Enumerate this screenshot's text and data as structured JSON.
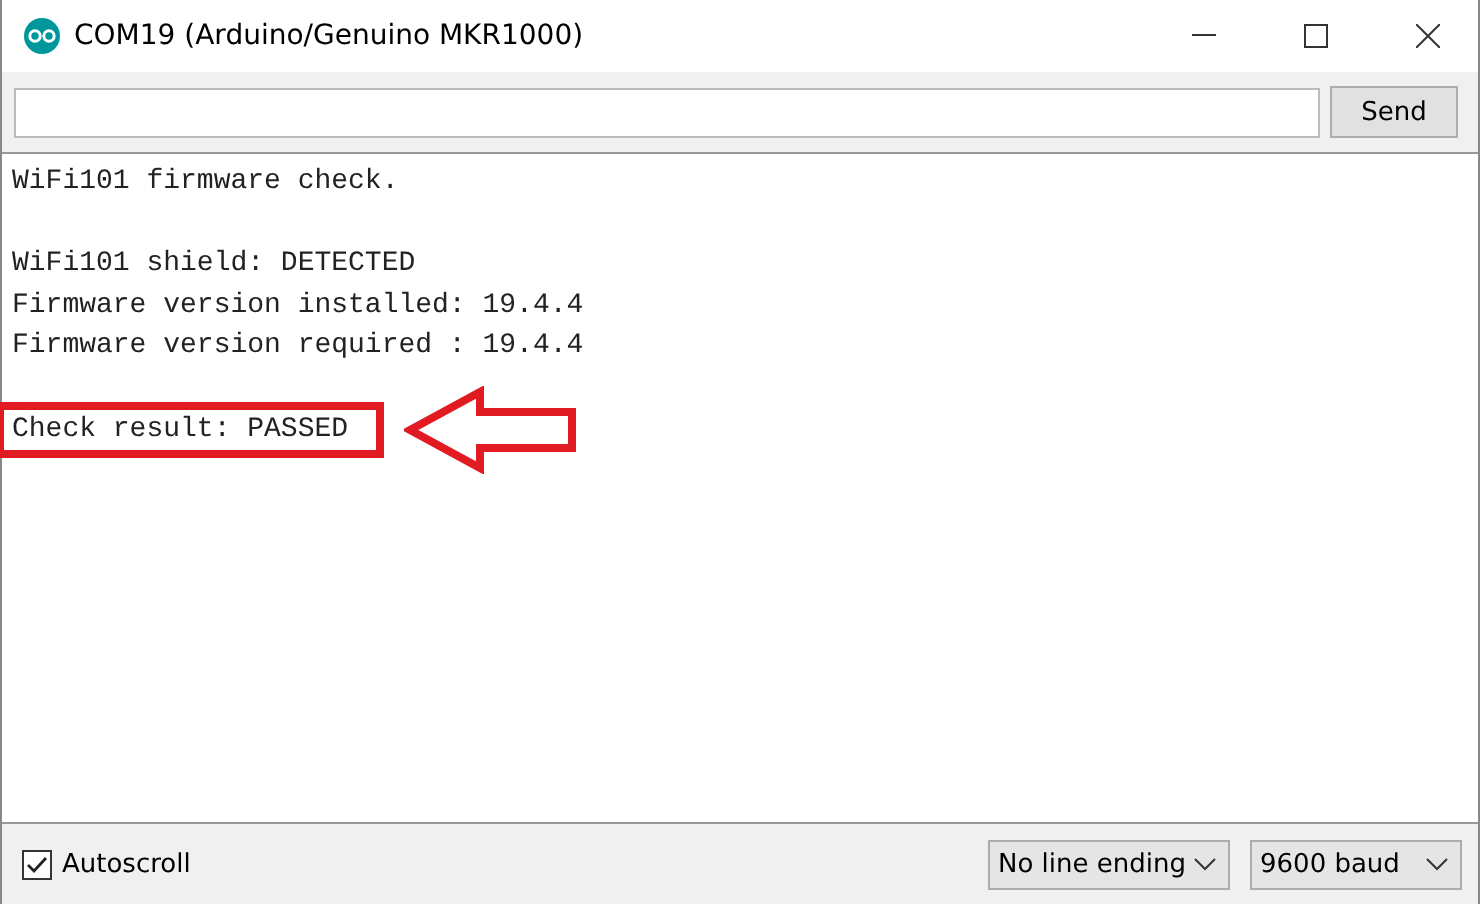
{
  "window": {
    "title": "COM19 (Arduino/Genuino MKR1000)"
  },
  "send_button": "Send",
  "output": [
    [
      {
        "text": "WiFi101 firmware check.",
        "highlighted": false
      }
    ],
    [
      {
        "text": "WiFi101 shield: DETECTED",
        "highlighted": false
      },
      {
        "text": "Firmware version installed: 19.4.4",
        "highlighted": false
      },
      {
        "text": "Firmware version required : 19.4.4",
        "highlighted": false
      }
    ],
    [
      {
        "text": "Check result: PASSED",
        "highlighted": true
      }
    ]
  ],
  "status_bar": {
    "autoscroll": {
      "label": "Autoscroll",
      "checked": true
    },
    "line_ending": "No line ending",
    "baud": "9600 baud"
  }
}
